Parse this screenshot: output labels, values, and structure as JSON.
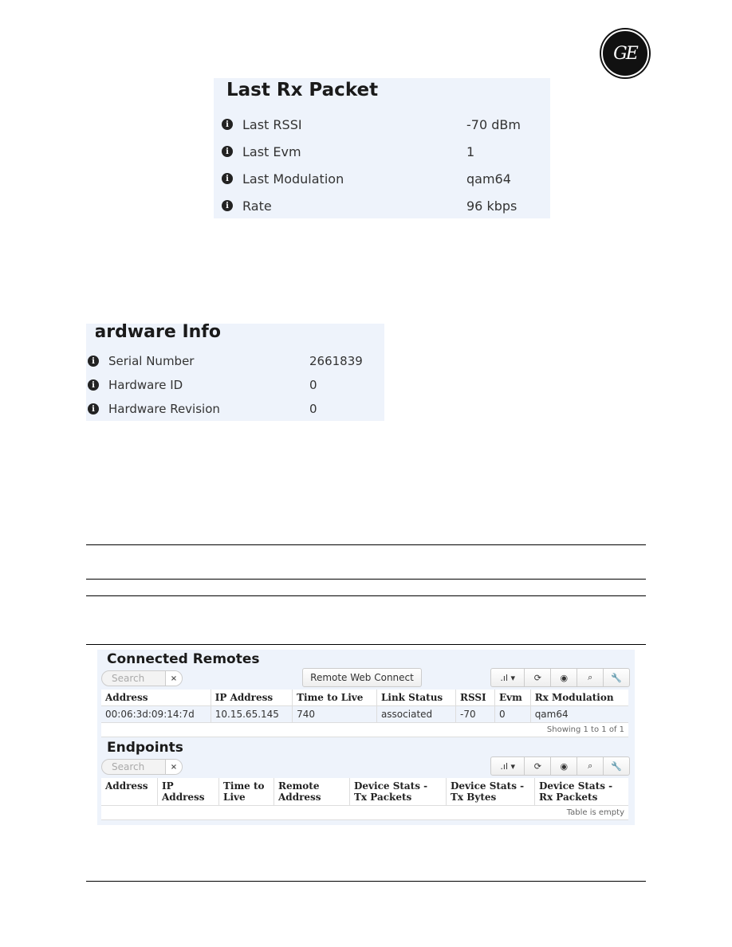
{
  "logo": {
    "text": "GE"
  },
  "last_rx_packet": {
    "title": "Last Rx Packet",
    "rows": [
      {
        "label": "Last RSSI",
        "value": "-70 dBm"
      },
      {
        "label": "Last Evm",
        "value": "1"
      },
      {
        "label": "Last Modulation",
        "value": "qam64"
      },
      {
        "label": "Rate",
        "value": "96 kbps"
      }
    ]
  },
  "hardware_info": {
    "title": "Hardware Info",
    "rows": [
      {
        "label": "Serial Number",
        "value": "2661839"
      },
      {
        "label": "Hardware ID",
        "value": "0"
      },
      {
        "label": "Hardware Revision",
        "value": "0"
      }
    ]
  },
  "connected_remotes": {
    "title": "Connected Remotes",
    "search_placeholder": "Search",
    "clear_label": "×",
    "remote_web_connect": "Remote Web Connect",
    "toolbar": {
      "columns": ".ıl ▾",
      "refresh": "⟳",
      "view": "◉",
      "search": "⌕",
      "settings": "🔧"
    },
    "columns": [
      "Address",
      "IP Address",
      "Time to Live",
      "Link Status",
      "RSSI",
      "Evm",
      "Rx Modulation"
    ],
    "rows": [
      [
        "00:06:3d:09:14:7d",
        "10.15.65.145",
        "740",
        "associated",
        "-70",
        "0",
        "qam64"
      ]
    ],
    "footer": "Showing 1 to 1 of 1"
  },
  "endpoints": {
    "title": "Endpoints",
    "search_placeholder": "Search",
    "clear_label": "×",
    "toolbar": {
      "columns": ".ıl ▾",
      "refresh": "⟳",
      "view": "◉",
      "search": "⌕",
      "settings": "🔧"
    },
    "columns": [
      "Address",
      "IP Address",
      "Time to Live",
      "Remote Address",
      "Device Stats - Tx Packets",
      "Device Stats - Tx Bytes",
      "Device Stats - Rx Packets"
    ],
    "footer": "Table is empty"
  }
}
